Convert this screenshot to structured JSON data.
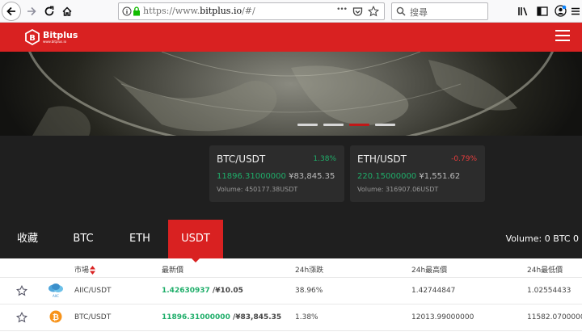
{
  "browser": {
    "url_prefix": "https://www.",
    "url_host": "bitplus.io",
    "url_path": "/#/",
    "search_placeholder": "搜尋",
    "more_glyph": "•••"
  },
  "site": {
    "logo_name": "Bitplus",
    "logo_sub": "www.bitplus.io"
  },
  "banner": {
    "slide_count": 4,
    "active_slide": 3
  },
  "tickers": [
    {
      "pair": "BTC/USDT",
      "change": "1.38%",
      "direction": "up",
      "price": "11896.31000000",
      "cny": "¥83,845.35",
      "volume": "Volume: 450177.38USDT"
    },
    {
      "pair": "ETH/USDT",
      "change": "-0.79%",
      "direction": "down",
      "price": "220.15000000",
      "cny": "¥1,551.62",
      "volume": "Volume: 316907.06USDT"
    }
  ],
  "tabs": [
    {
      "label": "收藏",
      "active": false
    },
    {
      "label": "BTC",
      "active": false
    },
    {
      "label": "ETH",
      "active": false
    },
    {
      "label": "USDT",
      "active": true
    }
  ],
  "volume_total": "Volume:  0 BTC 0",
  "table": {
    "headers": {
      "market": "市場",
      "last_price": "最新價",
      "change": "24h漲跌",
      "high": "24h最高價",
      "low": "24h最低價"
    },
    "rows": [
      {
        "icon": "aiic-coin-icon",
        "name": "AIIC/USDT",
        "last": "1.42630937",
        "last_cny": "/¥10.05",
        "change": "38.96%",
        "high": "1.42744847",
        "low": "1.02554433"
      },
      {
        "icon": "bitcoin-icon",
        "name": "BTC/USDT",
        "last": "11896.31000000",
        "last_cny": "/¥83,845.35",
        "change": "1.38%",
        "high": "12013.99000000",
        "low": "11582.07000000"
      }
    ]
  },
  "colors": {
    "brand_red": "#d92121",
    "up_green": "#1fae6a",
    "down_red": "#e53d3d",
    "dark_bg": "#1f1f1f"
  }
}
